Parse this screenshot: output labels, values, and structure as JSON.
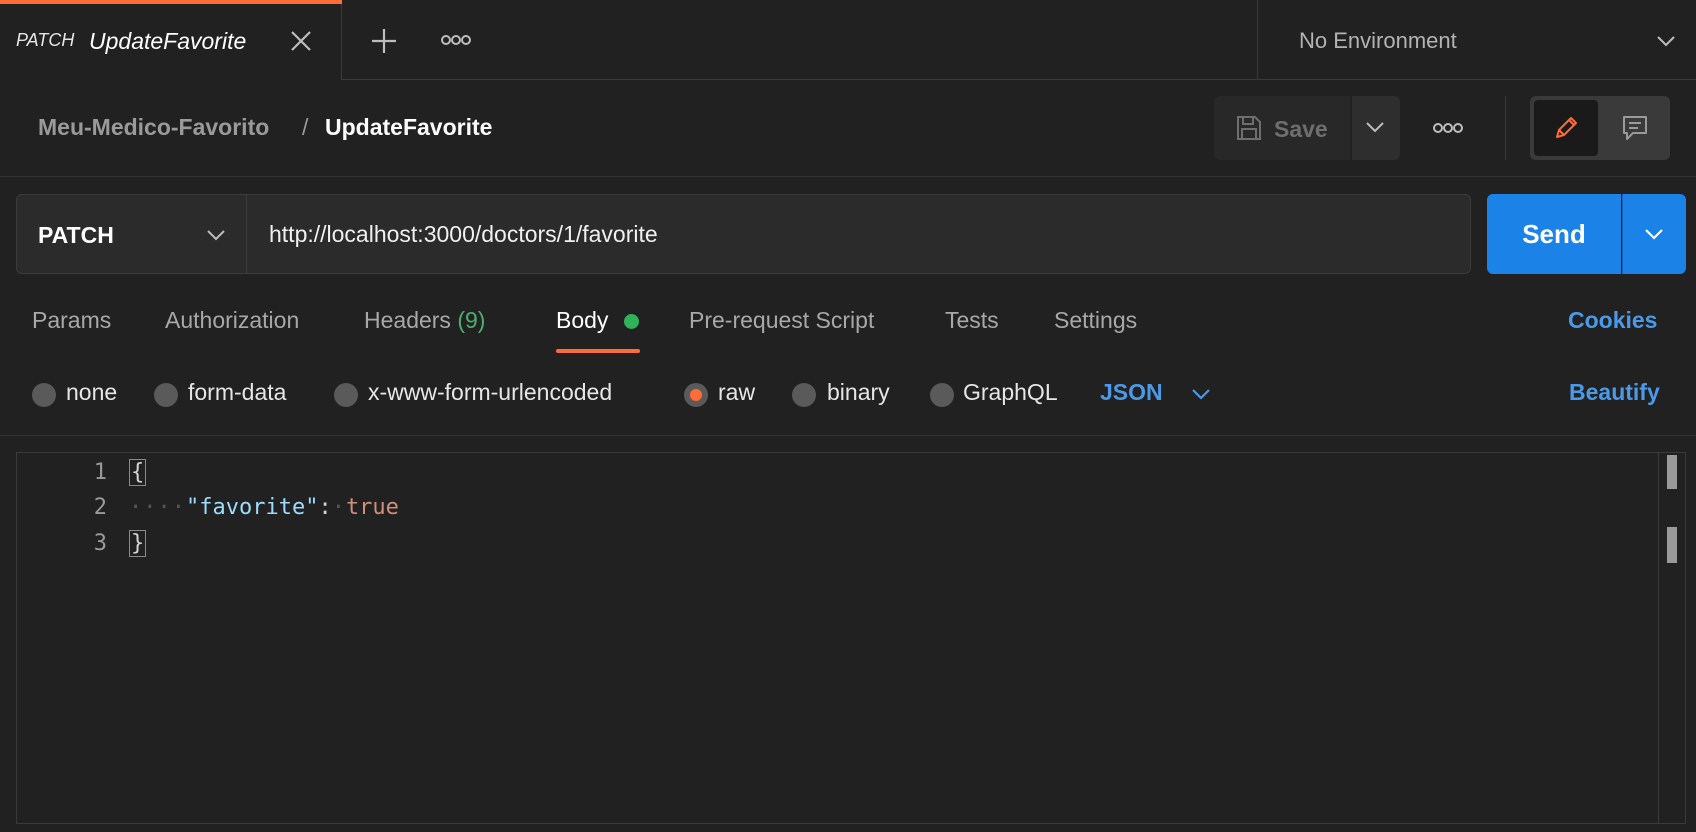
{
  "tab": {
    "method": "PATCH",
    "title": "UpdateFavorite"
  },
  "environment": {
    "label": "No Environment"
  },
  "breadcrumb": {
    "parent": "Meu-Medico-Favorito",
    "separator": "/",
    "current": "UpdateFavorite"
  },
  "toolbar": {
    "save_label": "Save"
  },
  "request": {
    "method": "PATCH",
    "url": "http://localhost:3000/doctors/1/favorite",
    "send_label": "Send"
  },
  "request_tabs": {
    "params": "Params",
    "authorization": "Authorization",
    "headers": "Headers",
    "headers_count": "(9)",
    "body": "Body",
    "pre_request": "Pre-request Script",
    "tests": "Tests",
    "settings": "Settings",
    "cookies": "Cookies"
  },
  "body_types": {
    "none": "none",
    "form_data": "form-data",
    "urlencoded": "x-www-form-urlencoded",
    "raw": "raw",
    "binary": "binary",
    "graphql": "GraphQL",
    "selected": "raw",
    "language": "JSON",
    "beautify": "Beautify"
  },
  "editor": {
    "line_numbers": [
      "1",
      "2",
      "3"
    ],
    "open_brace": "{",
    "indent_dots": "····",
    "key": "\"favorite\"",
    "colon": ":",
    "space_dot": "·",
    "value": "true",
    "close_brace": "}"
  },
  "colors": {
    "accent": "#ff6c37",
    "send": "#1b82e8",
    "link": "#4b9ae8",
    "success": "#2fb25a",
    "background": "#212121"
  }
}
